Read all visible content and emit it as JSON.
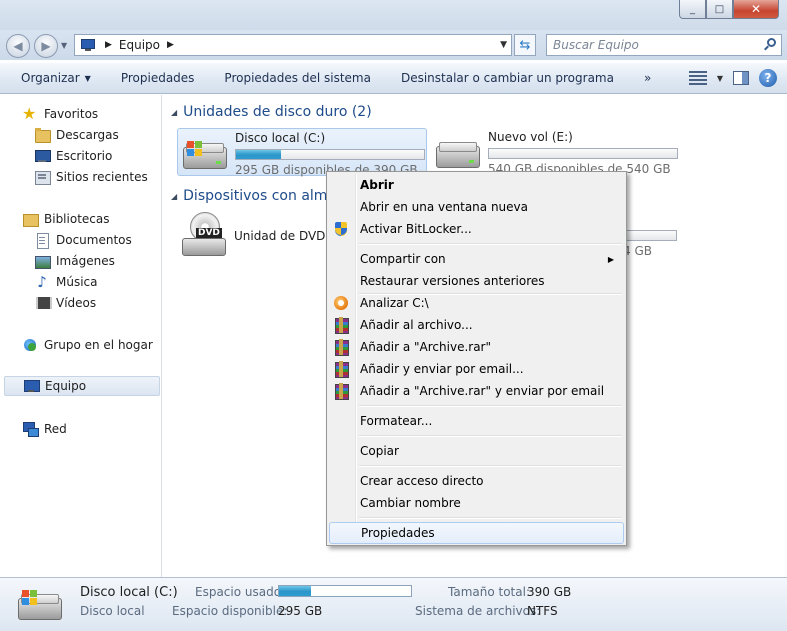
{
  "window": {
    "controls": [
      "_",
      "□",
      "✕"
    ]
  },
  "address": {
    "path": [
      "Equipo"
    ],
    "search_placeholder": "Buscar Equipo"
  },
  "toolbar": {
    "organize": "Organizar",
    "properties": "Propiedades",
    "system_properties": "Propiedades del sistema",
    "uninstall": "Desinstalar o cambiar un programa",
    "more": "»"
  },
  "sidebar": {
    "favorites": "Favoritos",
    "downloads": "Descargas",
    "desktop": "Escritorio",
    "recent": "Sitios recientes",
    "libraries": "Bibliotecas",
    "documents": "Documentos",
    "images": "Imágenes",
    "music": "Música",
    "videos": "Vídeos",
    "homegroup": "Grupo en el hogar",
    "computer": "Equipo",
    "network": "Red"
  },
  "groups": {
    "hard_drives": "Unidades de disco duro (2)",
    "removable": "Dispositivos con alma"
  },
  "drives": [
    {
      "name": "Disco local (C:)",
      "free": "295 GB disponibles de 390 GB",
      "used_fraction": 0.24
    },
    {
      "name": "Nuevo vol (E:)",
      "free": "540 GB disponibles de 540 GB",
      "used_fraction": 0.0
    }
  ],
  "dvd": {
    "name": "Unidad de DVD R",
    "badge": "DVD",
    "partial_free": "4 GB"
  },
  "context_menu": {
    "open": "Abrir",
    "open_new": "Abrir en una ventana nueva",
    "bitlocker": "Activar BitLocker...",
    "share": "Compartir con",
    "restore": "Restaurar versiones anteriores",
    "scan": "Analizar C:\\",
    "add_archive": "Añadir al archivo...",
    "add_rar": "Añadir a \"Archive.rar\"",
    "add_email": "Añadir y enviar por email...",
    "add_rar_email": "Añadir a \"Archive.rar\" y enviar por email",
    "format": "Formatear...",
    "copy": "Copiar",
    "shortcut": "Crear acceso directo",
    "rename": "Cambiar nombre",
    "properties": "Propiedades"
  },
  "details": {
    "name": "Disco local (C:)",
    "type": "Disco local",
    "used_label": "Espacio usado:",
    "used_fraction": 0.24,
    "free_label": "Espacio disponible:",
    "free_value": "295 GB",
    "total_label": "Tamaño total:",
    "total_value": "390 GB",
    "fs_label": "Sistema de archivos:",
    "fs_value": "NTFS"
  }
}
